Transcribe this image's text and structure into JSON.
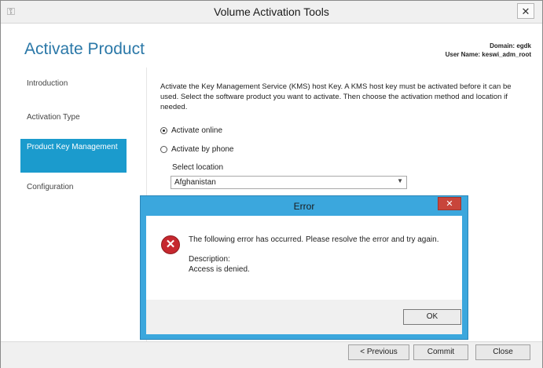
{
  "window": {
    "title": "Volume Activation Tools",
    "close_glyph": "✕",
    "app_icon": "volume-activation-icon"
  },
  "header": {
    "title": "Activate Product",
    "domain_label": "Domain: egdk",
    "user_label": "User Name: keswi_adm_root"
  },
  "sidebar": {
    "items": [
      {
        "label": "Introduction",
        "active": false
      },
      {
        "label": "Activation Type",
        "active": false
      },
      {
        "label": "Product Key Management",
        "active": true
      },
      {
        "label": "Configuration",
        "active": false
      }
    ]
  },
  "main": {
    "description": "Activate the Key Management Service (KMS) host Key. A KMS host key must be activated before it can be used. Select the software product you want to activate. Then choose the activation method and location if needed.",
    "options": [
      {
        "label": "Activate online",
        "checked": true
      },
      {
        "label": "Activate by phone",
        "checked": false
      }
    ],
    "select_label": "Select location",
    "select_value": "Afghanistan"
  },
  "footer": {
    "previous_label": "< Previous",
    "commit_label": "Commit",
    "close_label": "Close"
  },
  "dialog": {
    "title": "Error",
    "close_glyph": "✕",
    "message": "The following error has occurred. Please resolve the error and try again.",
    "description_label": "Description:",
    "description_text": "Access is denied.",
    "ok_label": "OK",
    "icon": "error-icon",
    "accent_color": "#3ba7dd"
  }
}
